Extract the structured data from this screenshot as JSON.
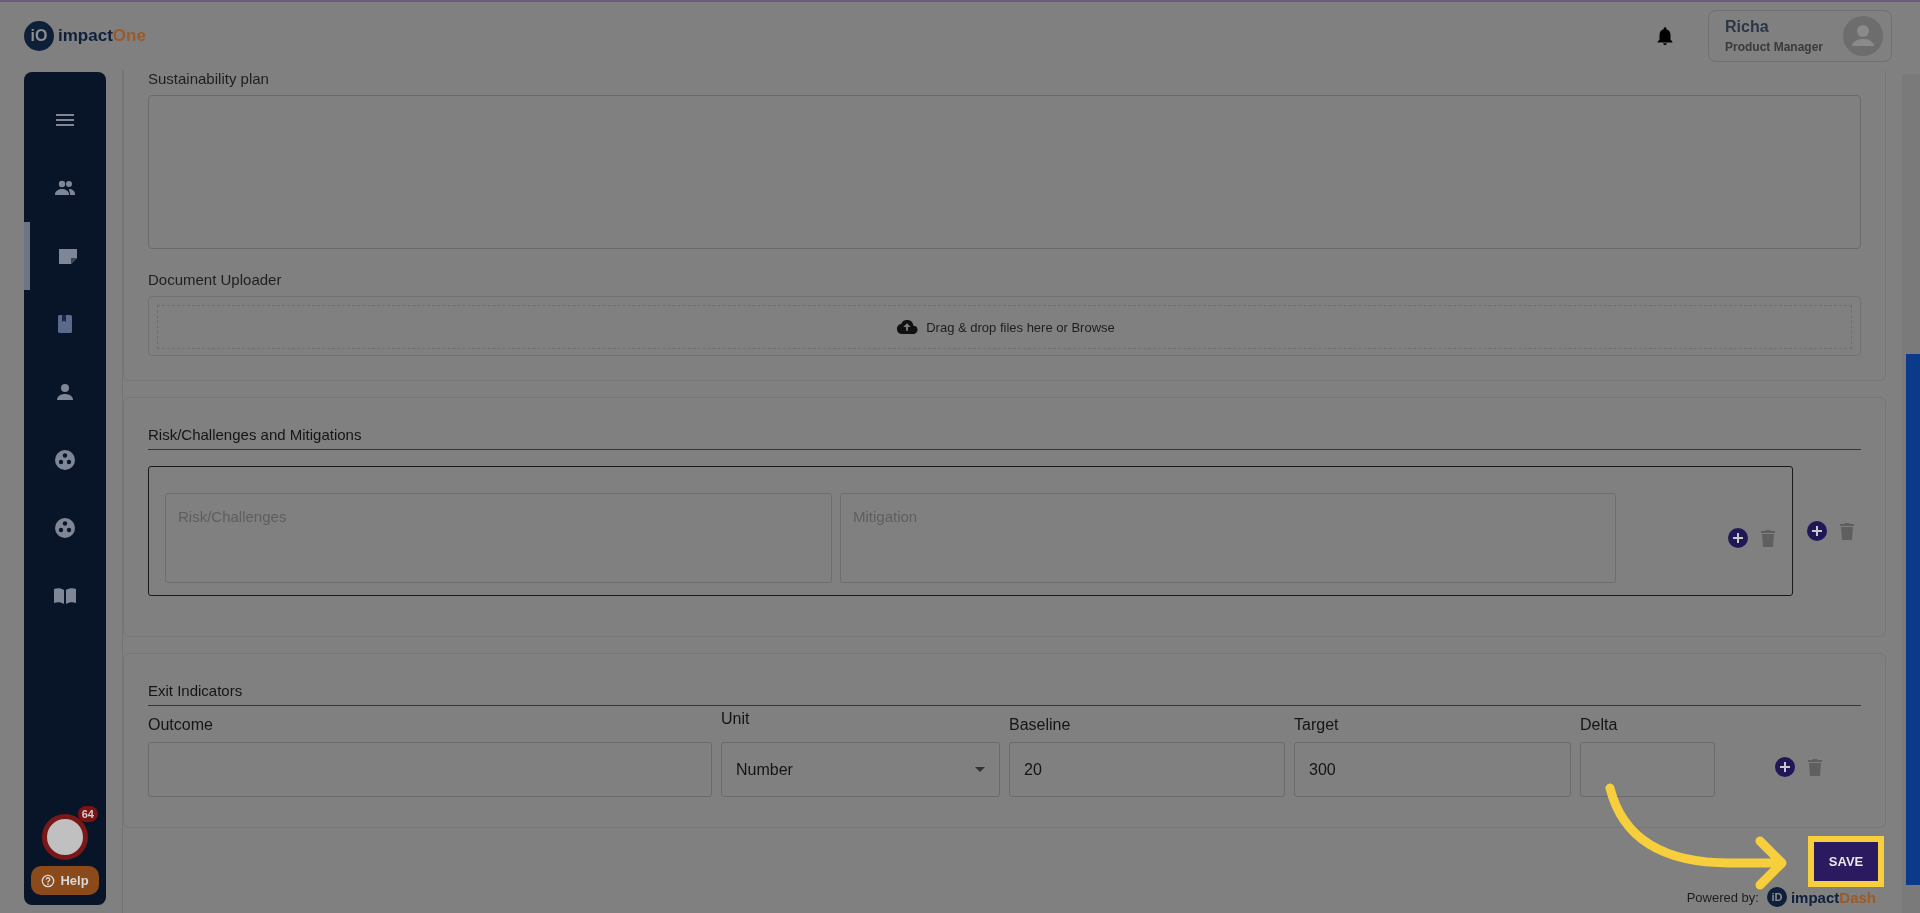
{
  "header": {
    "logo": {
      "mark": "iO",
      "prefix": "impact",
      "suffix": "One"
    },
    "user": {
      "name": "Richa",
      "role": "Product Manager"
    }
  },
  "sidebar": {
    "items": [
      {
        "kind": "menu",
        "selected": false
      },
      {
        "kind": "people",
        "selected": false
      },
      {
        "kind": "note",
        "selected": true
      },
      {
        "kind": "book",
        "selected": false
      },
      {
        "kind": "person",
        "selected": false
      },
      {
        "kind": "reel",
        "selected": false
      },
      {
        "kind": "reel",
        "selected": false
      },
      {
        "kind": "openbook",
        "selected": false
      }
    ]
  },
  "plan": {
    "label": "Sustainability plan"
  },
  "uploader": {
    "label": "Document Uploader",
    "hint": "Drag & drop files here or Browse"
  },
  "risks": {
    "title": "Risk/Challenges and Mitigations",
    "fields": [
      {
        "placeholder": "Risk/Challenges"
      },
      {
        "placeholder": "Mitigation"
      }
    ]
  },
  "exit_indicators": {
    "title": "Exit Indicators",
    "fields": [
      {
        "label": "Outcome",
        "kind": "text"
      },
      {
        "label": "Unit",
        "kind": "select",
        "value": "Number"
      },
      {
        "label": "Baseline",
        "kind": "text",
        "value": "20"
      },
      {
        "label": "Target",
        "kind": "text",
        "value": "300"
      },
      {
        "label": "Delta",
        "kind": "text"
      }
    ]
  },
  "save_button": "SAVE",
  "footer": {
    "powered_by": "Powered by:",
    "brand": {
      "mark": "iD",
      "prefix": "impact",
      "suffix": "Dash"
    }
  },
  "chat": {
    "badge": "64"
  },
  "help": {
    "label": "Help"
  }
}
